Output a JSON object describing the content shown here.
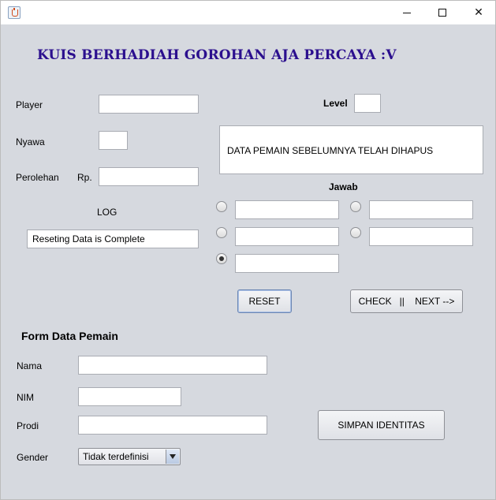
{
  "window": {
    "minimize_glyph": "",
    "close_glyph": "✕"
  },
  "heading": "KUIS BERHADIAH GOROHAN AJA PERCAYA :V",
  "game": {
    "player_label": "Player",
    "player_value": "",
    "level_label": "Level",
    "level_value": "",
    "nyawa_label": "Nyawa",
    "nyawa_value": "",
    "perolehan_label": "Perolehan",
    "rp_label": "Rp.",
    "perolehan_value": "",
    "log_label": "LOG",
    "log_value": "Reseting Data is Complete",
    "question_text": "DATA PEMAIN SEBELUMNYA TELAH DIHAPUS",
    "jawab_label": "Jawab",
    "answers": [
      "",
      "",
      "",
      "",
      ""
    ],
    "selected_answer": 5,
    "reset_button": "RESET",
    "check_next_button": "CHECK   ||    NEXT -->"
  },
  "form": {
    "title": "Form Data Pemain",
    "nama_label": "Nama",
    "nama_value": "",
    "nim_label": "NIM",
    "nim_value": "",
    "prodi_label": "Prodi",
    "prodi_value": "",
    "gender_label": "Gender",
    "gender_value": "Tidak terdefinisi",
    "save_button": "SIMPAN IDENTITAS"
  }
}
